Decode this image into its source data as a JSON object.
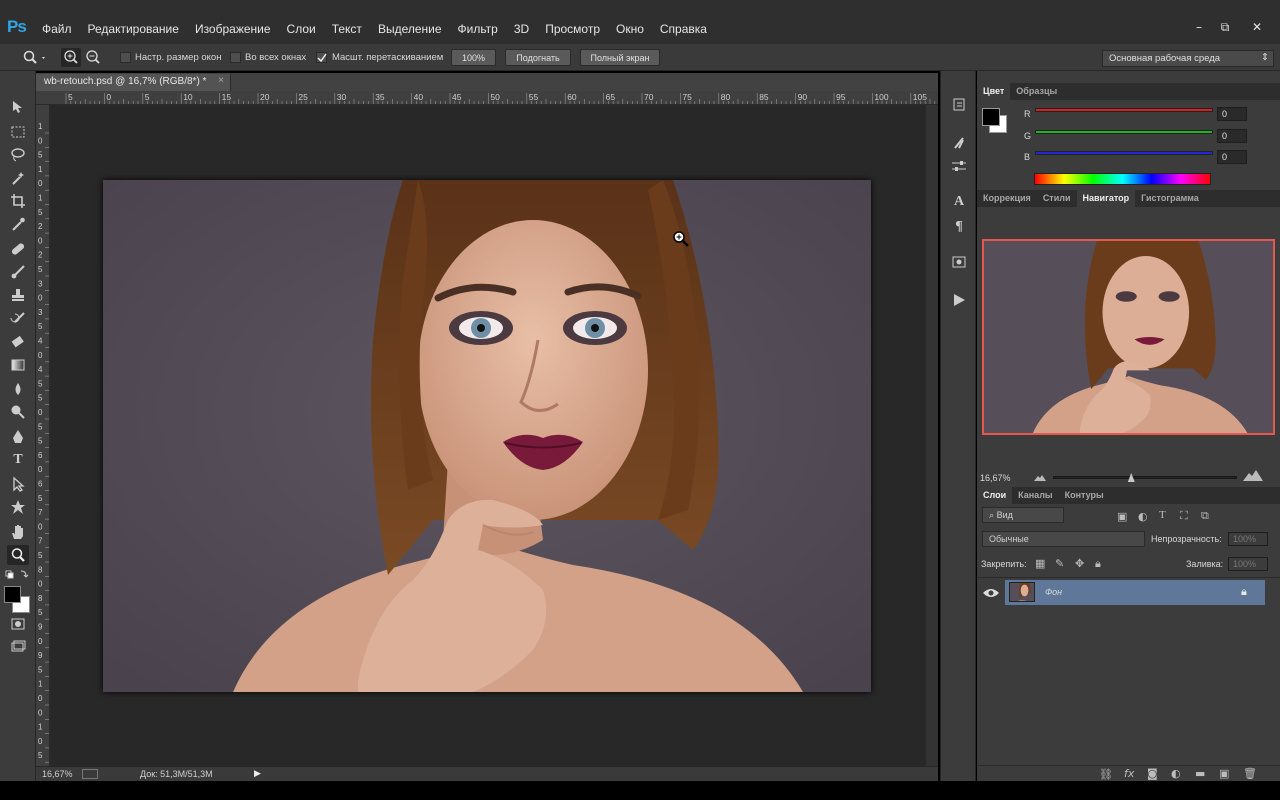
{
  "app": {
    "logo": "Ps"
  },
  "menu": [
    "Файл",
    "Редактирование",
    "Изображение",
    "Слои",
    "Текст",
    "Выделение",
    "Фильтр",
    "3D",
    "Просмотр",
    "Окно",
    "Справка"
  ],
  "window_controls": {
    "minimize": "–",
    "restore": "⧉",
    "close": "✕"
  },
  "options": {
    "resize_windows": "Настр. размер окон",
    "all_windows": "Во всех окнах",
    "scrubby_zoom": "Масшт. перетаскиванием",
    "scrubby_checked": true,
    "btn_100": "100%",
    "btn_fit": "Подогнать",
    "btn_fullscreen": "Полный экран",
    "workspace": "Основная рабочая среда"
  },
  "document": {
    "tab_title": "wb-retouch.psd @ 16,7% (RGB/8*) *",
    "tab_close": "×",
    "ruler_top": [
      "5",
      "0",
      "5",
      "10",
      "15",
      "20",
      "25",
      "30",
      "35",
      "40",
      "45",
      "50",
      "55",
      "60",
      "65",
      "70",
      "75",
      "80",
      "85",
      "90",
      "95",
      "100",
      "105"
    ],
    "ruler_left": [
      "1",
      "0",
      "5",
      "1",
      "0",
      "1",
      "5",
      "2",
      "0",
      "2",
      "5",
      "3",
      "0",
      "3",
      "5",
      "4",
      "0",
      "4",
      "5",
      "5",
      "0",
      "5",
      "5",
      "6",
      "0",
      "6",
      "5",
      "7",
      "0",
      "7",
      "5",
      "8",
      "0",
      "8",
      "5",
      "9",
      "0",
      "9",
      "5",
      "1",
      "0",
      "0",
      "1",
      "0",
      "5"
    ],
    "status_zoom": "16,67%",
    "status_doc": "Док: 51,3M/51,3M"
  },
  "color_panel": {
    "tabs": [
      "Цвет",
      "Образцы"
    ],
    "active_tab": "Цвет",
    "r_label": "R",
    "g_label": "G",
    "b_label": "B",
    "r_value": "0",
    "g_value": "0",
    "b_value": "0",
    "colors": {
      "r": "#d92020",
      "g": "#22b522",
      "b": "#2424d8"
    }
  },
  "navigator_panel": {
    "tabs": [
      "Коррекция",
      "Стили",
      "Навигатор",
      "Гистограмма"
    ],
    "active_tab": "Навигатор",
    "zoom": "16,67%",
    "zoom_level": 0.42
  },
  "layers_panel": {
    "tabs": [
      "Слои",
      "Каналы",
      "Контуры"
    ],
    "active_tab": "Слои",
    "filter": "Вид",
    "filter_icon": "⌕",
    "blend_mode": "Обычные",
    "opacity_label": "Непрозрачность:",
    "opacity_value": "100%",
    "lock_label": "Закрепить:",
    "fill_label": "Заливка:",
    "fill_value": "100%",
    "layers": [
      {
        "name": "Фон",
        "visible": true,
        "locked": true
      }
    ]
  },
  "colors": {
    "menubar": "#2f2f2f",
    "panel": "#3c3c3c",
    "canvas_bg": "#282828",
    "nav_border": "#e4584d",
    "layer_selected": "#5f7899",
    "ps_blue": "#33a4e6"
  }
}
